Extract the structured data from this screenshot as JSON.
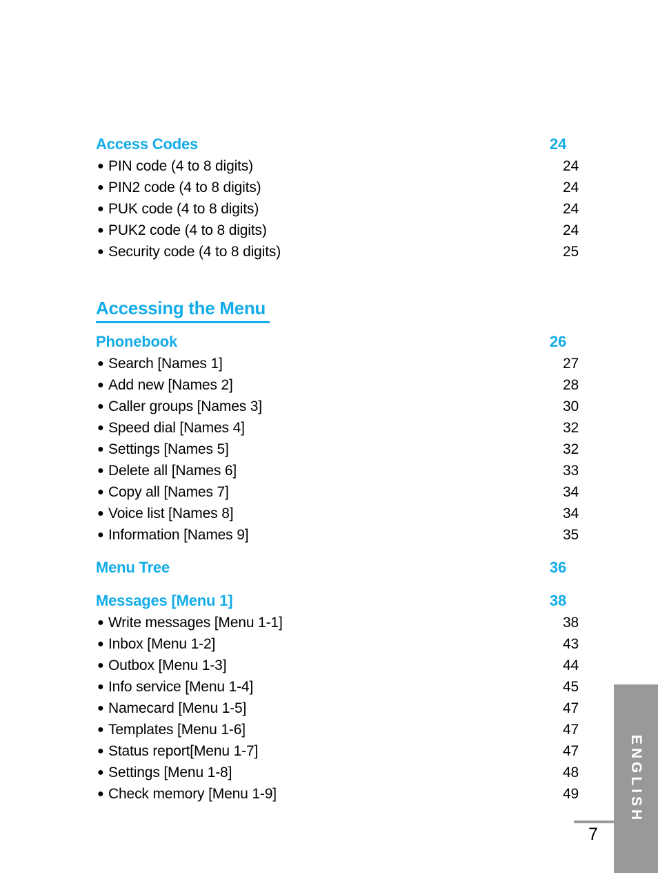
{
  "page": {
    "number": "7",
    "language_tab": "ENGLISH",
    "accent_color": "#13ACE8",
    "tab_color": "#999999"
  },
  "toc": {
    "blocks": [
      {
        "type": "chapter",
        "title": "Access Codes",
        "page": "24",
        "items": [
          {
            "label": "PIN code (4 to 8 digits)",
            "page": "24"
          },
          {
            "label": "PIN2 code (4 to 8 digits)",
            "page": "24"
          },
          {
            "label": "PUK code (4 to 8 digits)",
            "page": "24"
          },
          {
            "label": "PUK2 code (4 to 8 digits)",
            "page": "24"
          },
          {
            "label": "Security code (4 to 8 digits)",
            "page": "25"
          }
        ]
      },
      {
        "type": "section",
        "title": "Accessing the Menu"
      },
      {
        "type": "chapter",
        "title": "Phonebook",
        "page": "26",
        "items": [
          {
            "label": "Search [Names 1]",
            "page": "27"
          },
          {
            "label": "Add new [Names 2]",
            "page": "28"
          },
          {
            "label": "Caller groups [Names 3]",
            "page": "30"
          },
          {
            "label": "Speed dial [Names 4]",
            "page": "32"
          },
          {
            "label": "Settings [Names 5]",
            "page": "32"
          },
          {
            "label": "Delete all [Names 6]",
            "page": "33"
          },
          {
            "label": "Copy all [Names 7]",
            "page": "34"
          },
          {
            "label": "Voice list [Names 8]",
            "page": "34"
          },
          {
            "label": "Information [Names 9]",
            "page": "35"
          }
        ]
      },
      {
        "type": "chapter",
        "title": "Menu Tree",
        "page": "36",
        "items": []
      },
      {
        "type": "chapter",
        "title": "Messages [Menu 1]",
        "page": "38",
        "items": [
          {
            "label": "Write messages [Menu 1-1]",
            "page": "38"
          },
          {
            "label": "Inbox [Menu 1-2]",
            "page": "43"
          },
          {
            "label": "Outbox [Menu 1-3]",
            "page": "44"
          },
          {
            "label": "Info service [Menu 1-4]",
            "page": "45"
          },
          {
            "label": "Namecard [Menu 1-5]",
            "page": "47"
          },
          {
            "label": "Templates [Menu 1-6]",
            "page": "47"
          },
          {
            "label": "Status report[Menu 1-7]",
            "page": "47"
          },
          {
            "label": "Settings [Menu 1-8]",
            "page": "48"
          },
          {
            "label": "Check memory [Menu 1-9]",
            "page": "49"
          }
        ]
      }
    ]
  }
}
